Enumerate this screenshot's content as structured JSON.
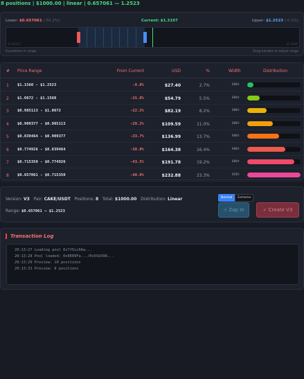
{
  "header": {
    "status": "8 positions | $1000.00 | linear | 0.657061 — 1.2523"
  },
  "range_selector": {
    "lower_label": "Lower:",
    "lower_value": "$0.657061",
    "lower_pct": "(-50.2%)",
    "current_label": "Current:",
    "current_value": "$1.3197",
    "upper_label": "Upper:",
    "upper_value": "$1.2523",
    "upper_pct": "(-5.1%)",
    "track_min": "$0.60337",
    "track_max": "$2.3090",
    "hint_left": "8 positions in range",
    "hint_right": "Drag handles to adjust range",
    "colors": {
      "lower_handle": "#ef5a5a",
      "upper_handle": "#4a8ef0",
      "current_line": "#4ade80"
    }
  },
  "table": {
    "headers": [
      "#",
      "Price Range",
      "From Current",
      "USD",
      "%",
      "Width",
      "Distribution"
    ],
    "rows": [
      {
        "num": "1",
        "range": "$1.1560 - $1.2523",
        "from": "-8.8%",
        "usd": "$27.40",
        "pct": "2.7%",
        "width": "800t",
        "dist": 0.12,
        "color": "#22c55e"
      },
      {
        "num": "2",
        "range": "$1.0672 - $1.1560",
        "from": "-15.8%",
        "usd": "$54.79",
        "pct": "5.5%",
        "width": "800t",
        "dist": 0.24,
        "color": "#84cc16"
      },
      {
        "num": "3",
        "range": "$0.985113 - $1.0672",
        "from": "-22.2%",
        "usd": "$82.19",
        "pct": "8.2%",
        "width": "800t",
        "dist": 0.36,
        "color": "#eab308"
      },
      {
        "num": "4",
        "range": "$0.909377 - $0.985113",
        "from": "-28.2%",
        "usd": "$109.59",
        "pct": "11.0%",
        "width": "800t",
        "dist": 0.48,
        "color": "#f59e0b"
      },
      {
        "num": "5",
        "range": "$0.839464 - $0.909377",
        "from": "-33.7%",
        "usd": "$136.99",
        "pct": "13.7%",
        "width": "800t",
        "dist": 0.6,
        "color": "#f97316"
      },
      {
        "num": "6",
        "range": "$0.774926 - $0.839464",
        "from": "-38.8%",
        "usd": "$164.38",
        "pct": "16.4%",
        "width": "800t",
        "dist": 0.72,
        "color": "#ef5a4a"
      },
      {
        "num": "7",
        "range": "$0.715350 - $0.774926",
        "from": "-43.5%",
        "usd": "$191.78",
        "pct": "19.2%",
        "width": "800t",
        "dist": 0.88,
        "color": "#f04a6a"
      },
      {
        "num": "8",
        "range": "$0.657061 - $0.715350",
        "from": "-48.0%",
        "usd": "$232.88",
        "pct": "23.3%",
        "width": "850t",
        "dist": 1.0,
        "color": "#ec4899"
      }
    ]
  },
  "summary": {
    "version_label": "Version:",
    "version": "V3",
    "pair_label": "Pair:",
    "pair": "CAKE/USDT",
    "positions_label": "Positions:",
    "positions": "8",
    "total_label": "Total:",
    "total": "$1000.00",
    "distribution_label": "Distribution:",
    "distribution": "Linear",
    "range_label": "Range:",
    "range": "$0.657061 — $1.2523",
    "mode_normal": "Normal",
    "mode_extreme": "Extreme",
    "zap_label": "⊹ Zap In",
    "create_label": "✓ Create V3"
  },
  "log": {
    "title": "Transaction Log",
    "lines": [
      "20:13:27 Loading pool 0x7f5ic6Aa...",
      "20:13:28 Pool loaded: 0x0E09Fa.../0x55d398...",
      "20:13:29 Preview: 10 positions",
      "20:13:31 Preview: 8 positions"
    ]
  }
}
